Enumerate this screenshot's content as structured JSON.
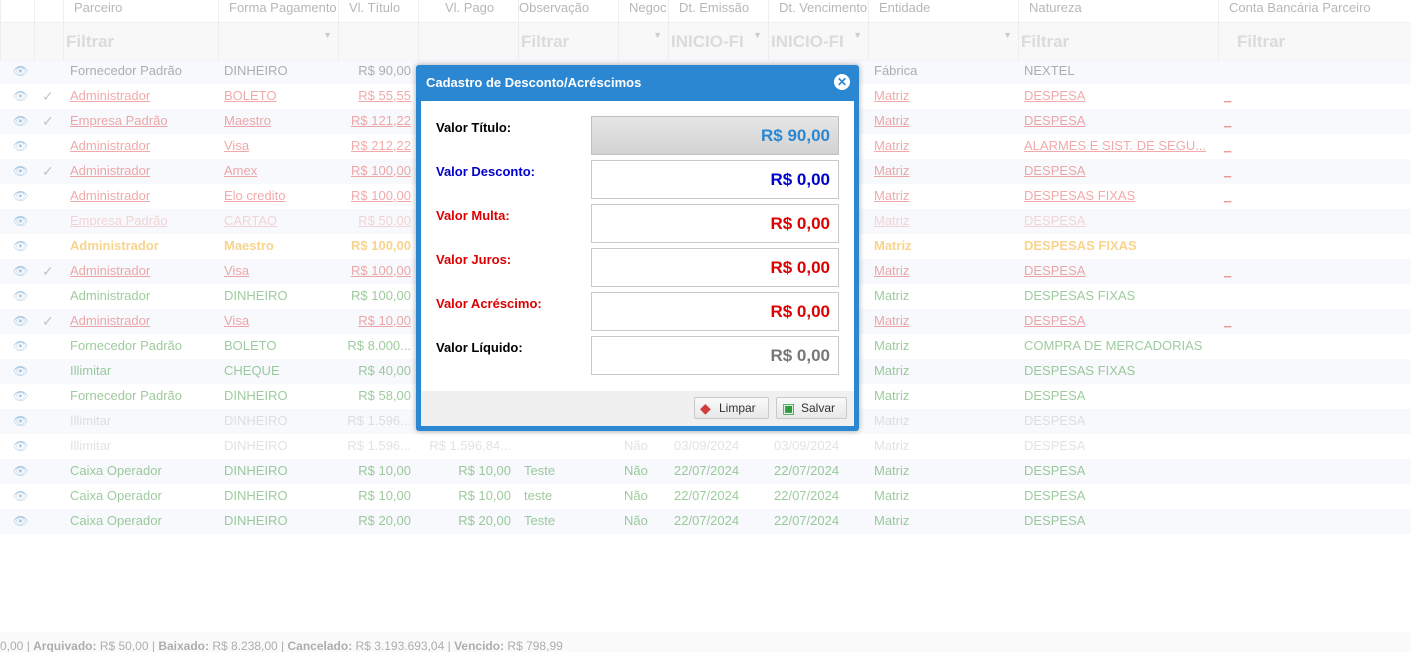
{
  "grid": {
    "columns": [
      "Parceiro",
      "Forma Pagamento",
      "Vl. Título",
      "Vl. Pago",
      "Observação",
      "Negoc",
      "Dt. Emissão",
      "Dt. Vencimento",
      "Entidade",
      "Natureza",
      "Conta Bancária Parceiro"
    ],
    "filters": {
      "parceiro": "Filtrar",
      "observacao": "Filtrar",
      "dt_emissao": "INICIO-FI",
      "dt_vencimento": "INICIO-FI",
      "natureza": "Filtrar",
      "conta": "Filtrar"
    },
    "rows": [
      {
        "parceiro": "Fornecedor Padrão",
        "forma": "DINHEIRO",
        "vl_titulo": "R$ 90,00",
        "vl_pago": "",
        "obs": "",
        "negoc": "",
        "dt_emissao": "",
        "dt_venc": "",
        "entidade": "Fábrica",
        "natureza": "NEXTEL",
        "conta": "",
        "check": "",
        "style": "gray"
      },
      {
        "parceiro": "Administrador",
        "forma": "BOLETO",
        "vl_titulo": "R$ 55,55",
        "vl_pago": "",
        "obs": "",
        "negoc": "",
        "dt_emissao": "",
        "dt_venc": "",
        "entidade": "Matriz",
        "natureza": "DESPESA",
        "conta": "_",
        "check": "✓",
        "style": "red"
      },
      {
        "parceiro": "Empresa Padrão",
        "forma": "Maestro",
        "vl_titulo": "R$ 121,22",
        "vl_pago": "",
        "obs": "",
        "negoc": "",
        "dt_emissao": "",
        "dt_venc": "",
        "entidade": "Matriz",
        "natureza": "DESPESA",
        "conta": "_",
        "check": "✓",
        "style": "red"
      },
      {
        "parceiro": "Administrador",
        "forma": "Visa",
        "vl_titulo": "R$ 212,22",
        "vl_pago": "",
        "obs": "",
        "negoc": "",
        "dt_emissao": "",
        "dt_venc": "",
        "entidade": "Matriz",
        "natureza": "ALARMES E SIST. DE SEGU...",
        "conta": "_",
        "check": "",
        "style": "red"
      },
      {
        "parceiro": "Administrador",
        "forma": "Amex",
        "vl_titulo": "R$ 100,00",
        "vl_pago": "",
        "obs": "",
        "negoc": "",
        "dt_emissao": "",
        "dt_venc": "",
        "entidade": "Matriz",
        "natureza": "DESPESA",
        "conta": "_",
        "check": "✓",
        "style": "red"
      },
      {
        "parceiro": "Administrador",
        "forma": "Elo credito",
        "vl_titulo": "R$ 100,00",
        "vl_pago": "",
        "obs": "",
        "negoc": "",
        "dt_emissao": "",
        "dt_venc": "",
        "entidade": "Matriz",
        "natureza": "DESPESAS FIXAS",
        "conta": "_",
        "check": "",
        "style": "red"
      },
      {
        "parceiro": "Empresa Padrão",
        "forma": "CARTAO",
        "vl_titulo": "R$ 50,00",
        "vl_pago": "",
        "obs": "",
        "negoc": "",
        "dt_emissao": "",
        "dt_venc": "",
        "entidade": "Matriz",
        "natureza": "DESPESA",
        "conta": "",
        "check": "",
        "style": "faintred"
      },
      {
        "parceiro": "Administrador",
        "forma": "Maestro",
        "vl_titulo": "R$ 100,00",
        "vl_pago": "",
        "obs": "",
        "negoc": "",
        "dt_emissao": "",
        "dt_venc": "",
        "entidade": "Matriz",
        "natureza": "DESPESAS FIXAS",
        "conta": "",
        "check": "",
        "style": "orange"
      },
      {
        "parceiro": "Administrador",
        "forma": "Visa",
        "vl_titulo": "R$ 100,00",
        "vl_pago": "",
        "obs": "",
        "negoc": "",
        "dt_emissao": "",
        "dt_venc": "",
        "entidade": "Matriz",
        "natureza": "DESPESA",
        "conta": "_",
        "check": "✓",
        "style": "red"
      },
      {
        "parceiro": "Administrador",
        "forma": "DINHEIRO",
        "vl_titulo": "R$ 100,00",
        "vl_pago": "",
        "obs": "",
        "negoc": "",
        "dt_emissao": "",
        "dt_venc": "",
        "entidade": "Matriz",
        "natureza": "DESPESAS FIXAS",
        "conta": "",
        "check": "",
        "style": "green"
      },
      {
        "parceiro": "Administrador",
        "forma": "Visa",
        "vl_titulo": "R$ 10,00",
        "vl_pago": "",
        "obs": "",
        "negoc": "",
        "dt_emissao": "",
        "dt_venc": "",
        "entidade": "Matriz",
        "natureza": "DESPESA",
        "conta": "_",
        "check": "✓",
        "style": "red"
      },
      {
        "parceiro": "Fornecedor Padrão",
        "forma": "BOLETO",
        "vl_titulo": "R$ 8.000...",
        "vl_pago": "",
        "obs": "",
        "negoc": "",
        "dt_emissao": "",
        "dt_venc": "",
        "entidade": "Matriz",
        "natureza": "COMPRA DE MERCADORIAS",
        "conta": "",
        "check": "",
        "style": "green"
      },
      {
        "parceiro": "Illimitar",
        "forma": "CHEQUE",
        "vl_titulo": "R$ 40,00",
        "vl_pago": "",
        "obs": "",
        "negoc": "",
        "dt_emissao": "",
        "dt_venc": "",
        "entidade": "Matriz",
        "natureza": "DESPESAS FIXAS",
        "conta": "",
        "check": "",
        "style": "green"
      },
      {
        "parceiro": "Fornecedor Padrão",
        "forma": "DINHEIRO",
        "vl_titulo": "R$ 58,00",
        "vl_pago": "",
        "obs": "",
        "negoc": "",
        "dt_emissao": "",
        "dt_venc": "",
        "entidade": "Matriz",
        "natureza": "DESPESA",
        "conta": "",
        "check": "",
        "style": "green"
      },
      {
        "parceiro": "Illimitar",
        "forma": "DINHEIRO",
        "vl_titulo": "R$ 1.596...",
        "vl_pago": "",
        "obs": "",
        "negoc": "",
        "dt_emissao": "",
        "dt_venc": "",
        "entidade": "Matriz",
        "natureza": "DESPESA",
        "conta": "",
        "check": "",
        "style": "faint"
      },
      {
        "parceiro": "Illimitar",
        "forma": "DINHEIRO",
        "vl_titulo": "R$ 1.596...",
        "vl_pago": "R$ 1.596,84...",
        "obs": "",
        "negoc": "Não",
        "dt_emissao": "03/09/2024",
        "dt_venc": "03/09/2024",
        "entidade": "Matriz",
        "natureza": "DESPESA",
        "conta": "",
        "check": "",
        "style": "faint"
      },
      {
        "parceiro": "Caixa Operador",
        "forma": "DINHEIRO",
        "vl_titulo": "R$ 10,00",
        "vl_pago": "R$ 10,00",
        "obs": "Teste",
        "negoc": "Não",
        "dt_emissao": "22/07/2024",
        "dt_venc": "22/07/2024",
        "entidade": "Matriz",
        "natureza": "DESPESA",
        "conta": "",
        "check": "",
        "style": "green"
      },
      {
        "parceiro": "Caixa Operador",
        "forma": "DINHEIRO",
        "vl_titulo": "R$ 10,00",
        "vl_pago": "R$ 10,00",
        "obs": "teste",
        "negoc": "Não",
        "dt_emissao": "22/07/2024",
        "dt_venc": "22/07/2024",
        "entidade": "Matriz",
        "natureza": "DESPESA",
        "conta": "",
        "check": "",
        "style": "green"
      },
      {
        "parceiro": "Caixa Operador",
        "forma": "DINHEIRO",
        "vl_titulo": "R$ 20,00",
        "vl_pago": "R$ 20,00",
        "obs": "Teste",
        "negoc": "Não",
        "dt_emissao": "22/07/2024",
        "dt_venc": "22/07/2024",
        "entidade": "Matriz",
        "natureza": "DESPESA",
        "conta": "",
        "check": "",
        "style": "green"
      }
    ]
  },
  "footer": {
    "lead": "0,00 | ",
    "arquivado_label": "Arquivado:",
    "arquivado_value": " R$ 50,00 | ",
    "baixado_label": "Baixado:",
    "baixado_value": " R$ 8.238,00 | ",
    "cancelado_label": "Cancelado:",
    "cancelado_value": " R$ 3.193.693,04 | ",
    "vencido_label": "Vencido:",
    "vencido_value": " R$ 798,99"
  },
  "modal": {
    "title": "Cadastro de Desconto/Acréscimos",
    "close_glyph": "✕",
    "fields": [
      {
        "label": "Valor Título:",
        "value": "R$ 90,00",
        "label_color": "#000000",
        "value_color": "#2b87d1"
      },
      {
        "label": "Valor Desconto:",
        "value": "R$ 0,00",
        "label_color": "#0000cc",
        "value_color": "#0000cc"
      },
      {
        "label": "Valor Multa:",
        "value": "R$ 0,00",
        "label_color": "#dd0000",
        "value_color": "#dd0000"
      },
      {
        "label": "Valor Juros:",
        "value": "R$ 0,00",
        "label_color": "#dd0000",
        "value_color": "#dd0000"
      },
      {
        "label": "Valor Acréscimo:",
        "value": "R$ 0,00",
        "label_color": "#dd0000",
        "value_color": "#dd0000"
      },
      {
        "label": "Valor Líquido:",
        "value": "R$ 0,00",
        "label_color": "#000000",
        "value_color": "#777777"
      }
    ],
    "buttons": {
      "limpar": "Limpar",
      "salvar": "Salvar"
    }
  }
}
